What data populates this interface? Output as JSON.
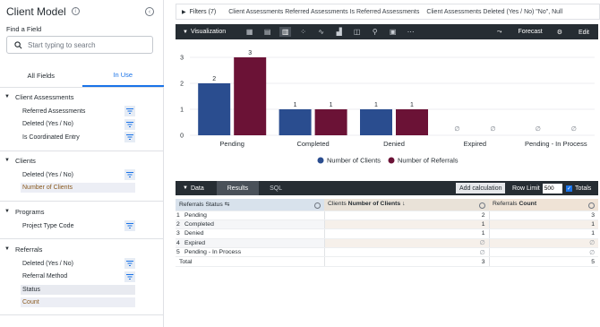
{
  "sidebar": {
    "title": "Client Model",
    "info_icon": "i",
    "collapse_icon": "‹",
    "find_label": "Find a Field",
    "search_placeholder": "Start typing to search",
    "tabs": [
      {
        "label": "All Fields",
        "active": false
      },
      {
        "label": "In Use",
        "active": true
      }
    ],
    "sections": [
      {
        "name": "Client Assessments",
        "fields": [
          {
            "label": "Referred Assessments",
            "filter": true
          },
          {
            "label": "Deleted (Yes / No)",
            "filter": true
          },
          {
            "label": "Is Coordinated Entry",
            "filter": true
          }
        ]
      },
      {
        "name": "Clients",
        "fields": [
          {
            "label": "Deleted (Yes / No)",
            "filter": true
          },
          {
            "label": "Number of Clients",
            "filter": false
          }
        ]
      },
      {
        "name": "Programs",
        "fields": [
          {
            "label": "Project Type Code",
            "filter": true
          }
        ]
      },
      {
        "name": "Referrals",
        "fields": [
          {
            "label": "Deleted (Yes / No)",
            "filter": true
          },
          {
            "label": "Referral Method",
            "filter": true
          },
          {
            "label": "Status",
            "filter": false
          },
          {
            "label": "Count",
            "filter": false
          }
        ]
      }
    ]
  },
  "filters": {
    "title": "Filters (7)",
    "items": [
      "Client Assessments Referred Assessments Is Referred Assessments",
      "Client Assessments Deleted (Yes / No) \"No\", Null"
    ]
  },
  "visualization": {
    "title": "Visualization",
    "forecast_label": "Forecast",
    "edit_label": "Edit",
    "icons": [
      "table-icon",
      "grid-icon",
      "bar-chart-icon",
      "scatter-icon",
      "line-chart-icon",
      "area-chart-icon",
      "map-icon",
      "pin-icon",
      "single-value-icon",
      "more-icon"
    ]
  },
  "chart_data": {
    "type": "bar",
    "categories": [
      "Pending",
      "Completed",
      "Denied",
      "Expired",
      "Pending - In Process"
    ],
    "series": [
      {
        "name": "Number of Clients",
        "color": "#2a4d8f",
        "values": [
          2,
          1,
          1,
          null,
          null
        ],
        "labels": [
          "2",
          "1",
          "1",
          "∅",
          "∅"
        ]
      },
      {
        "name": "Number of Referrals",
        "color": "#6b1236",
        "values": [
          3,
          1,
          1,
          null,
          null
        ],
        "labels": [
          "3",
          "1",
          "1",
          "∅",
          "∅"
        ]
      }
    ],
    "yticks": [
      "0",
      "1",
      "2",
      "3"
    ],
    "ylim": [
      0,
      3
    ],
    "legend_position": "bottom"
  },
  "data_panel": {
    "title": "Data",
    "tabs": [
      {
        "label": "Results",
        "active": true
      },
      {
        "label": "SQL",
        "active": false
      }
    ],
    "add_calculation_label": "Add calculation",
    "row_limit_label": "Row Limit",
    "row_limit_value": "500",
    "totals_label": "Totals",
    "columns": {
      "dim": "Referrals Status",
      "m1_prefix": "Clients",
      "m1": "Number of Clients",
      "m2_prefix": "Referrals",
      "m2": "Count"
    },
    "rows": [
      {
        "index": "1",
        "status": "Pending",
        "clients": "2",
        "count": "3"
      },
      {
        "index": "2",
        "status": "Completed",
        "clients": "1",
        "count": "1"
      },
      {
        "index": "3",
        "status": "Denied",
        "clients": "1",
        "count": "1"
      },
      {
        "index": "4",
        "status": "Expired",
        "clients": "∅",
        "count": "∅"
      },
      {
        "index": "5",
        "status": "Pending - In Process",
        "clients": "∅",
        "count": "∅"
      }
    ],
    "total_label": "Total",
    "total_clients": "3",
    "total_count": "5"
  }
}
